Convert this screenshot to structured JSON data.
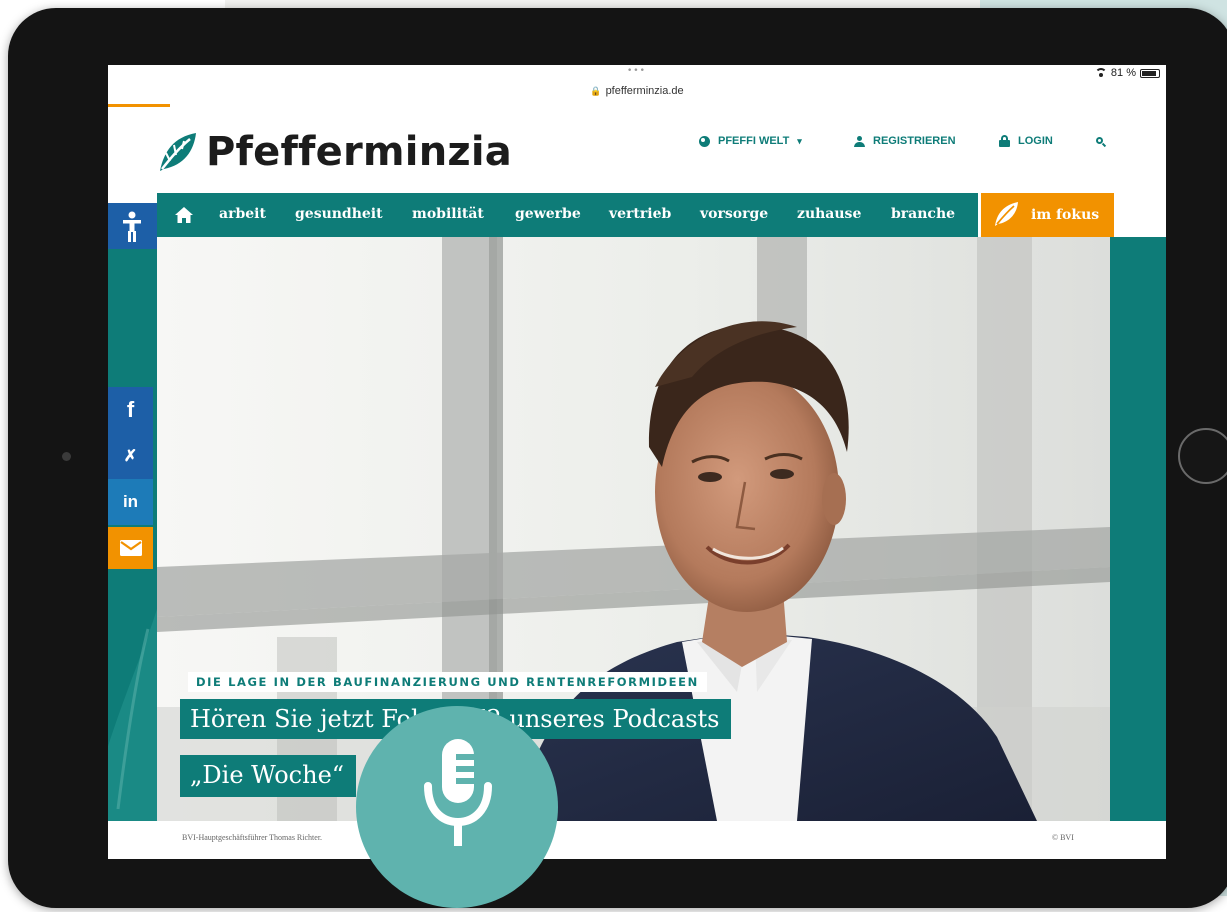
{
  "browser": {
    "tab_dots": "•••",
    "url": "pfefferminzia.de",
    "battery_percent": "81 %"
  },
  "logo": {
    "text": "Pfefferminzia"
  },
  "top_nav": {
    "world": "PFEFFI WELT",
    "register": "REGISTRIEREN",
    "login": "LOGIN"
  },
  "main_nav": {
    "items": [
      "arbeit",
      "gesundheit",
      "mobilität",
      "gewerbe",
      "vertrieb",
      "vorsorge",
      "zuhause",
      "branche"
    ],
    "focus": "im fokus"
  },
  "share": {
    "facebook": "f",
    "xing": "✗",
    "linkedin": "in"
  },
  "hero": {
    "kicker": "DIE LAGE IN DER BAUFINANZIERUNG UND RENTENREFORMIDEEN",
    "headline_line1": "Hören Sie jetzt Folge 172 unseres Podcasts",
    "headline_line2": "„Die Woche“",
    "caption": "BVI-Hauptgeschäftsführer Thomas Richter.",
    "credit": "© BVI"
  },
  "colors": {
    "teal": "#0e7c78",
    "orange": "#f29200",
    "blue": "#1d5fa7",
    "mic_circle": "#5fb3ae"
  }
}
